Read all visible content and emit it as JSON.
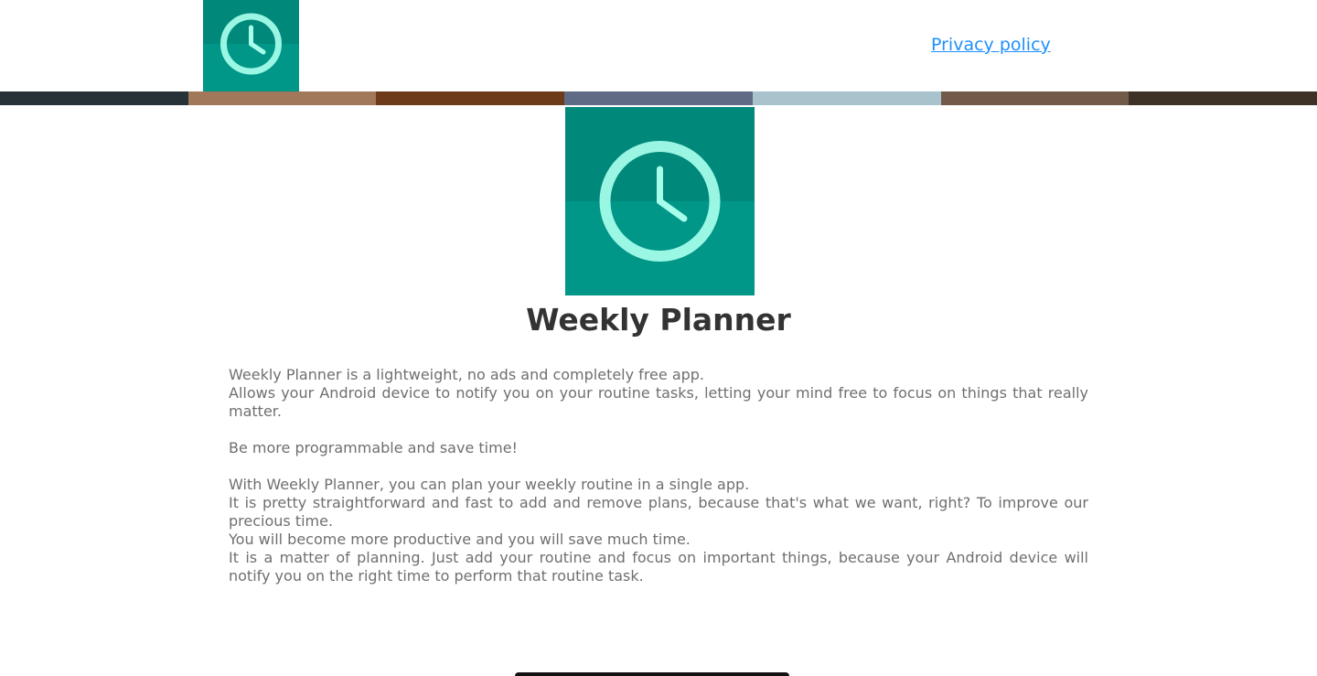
{
  "header": {
    "logo_icon": "clock-icon",
    "privacy_link": "Privacy policy"
  },
  "color_strip": [
    "#263238",
    "#a1785a",
    "#6d3a1a",
    "#5f6b85",
    "#a8c3cc",
    "#725a4b",
    "#3e3126"
  ],
  "brand_colors": {
    "tile_top": "#00897b",
    "tile_bottom": "#009688",
    "clock_face": "#a7ffeb",
    "link": "#1e90ff",
    "title": "#333333",
    "body_text": "#6f6f6f"
  },
  "hero": {
    "logo_icon": "clock-icon",
    "title": "Weekly Planner"
  },
  "description": {
    "p1_line1": "Weekly Planner is a lightweight, no ads and completely free app.",
    "p1_line2": "Allows your Android device to notify you on your routine tasks, letting your mind free to focus on things that really matter.",
    "p2": "Be more programmable and save time!",
    "p3_line1": "With Weekly Planner, you can plan your weekly routine in a single app.",
    "p3_line2": "It is pretty straightforward and fast to add and remove plans, because that's what we want, right? To improve our precious time.",
    "p3_line3": "You will become more productive and you will save much time.",
    "p3_line4": "It is a matter of planning. Just add your routine and focus on important things, because your Android device will notify you on the right time to perform that routine task."
  }
}
